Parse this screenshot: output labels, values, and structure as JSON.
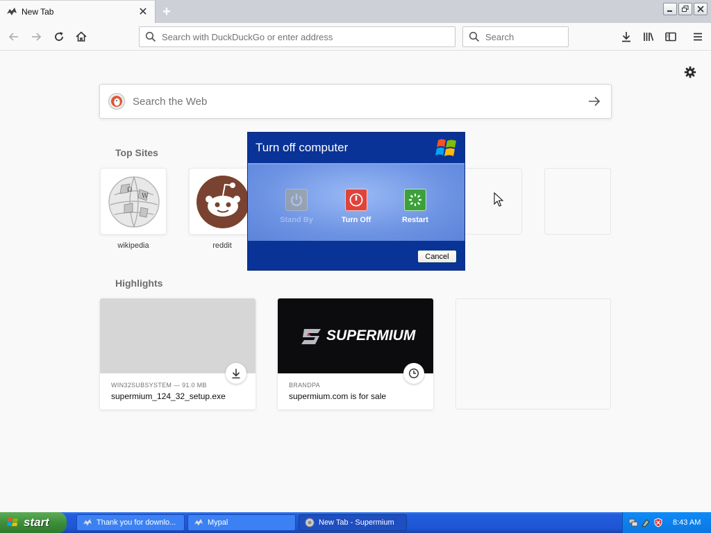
{
  "browser": {
    "tab": {
      "title": "New Tab",
      "close_glyph": "✕"
    },
    "new_tab_glyph": "+",
    "urlbar": {
      "placeholder": "Search with DuckDuckGo or enter address"
    },
    "searchbar": {
      "placeholder": "Search"
    }
  },
  "newtab": {
    "web_search_placeholder": "Search the Web",
    "top_sites_title": "Top Sites",
    "top_sites": [
      {
        "label": "wikipedia"
      },
      {
        "label": "reddit"
      }
    ],
    "highlights_title": "Highlights",
    "highlights": [
      {
        "meta": "WIN32SUBSYSTEM — 91.0 MB",
        "name": "supermium_124_32_setup.exe",
        "badge_icon": "download-icon"
      },
      {
        "meta": "BRANDPA",
        "name": "supermium.com is for sale",
        "badge_icon": "clock-icon",
        "logo_text": "SUPERMIUM"
      }
    ]
  },
  "dialog": {
    "title": "Turn off computer",
    "options": [
      {
        "label": "Stand By",
        "icon": "standby-icon",
        "enabled": false
      },
      {
        "label": "Turn Off",
        "icon": "power-icon",
        "enabled": true
      },
      {
        "label": "Restart",
        "icon": "restart-icon",
        "enabled": true
      }
    ],
    "cancel_label": "Cancel"
  },
  "taskbar": {
    "start_label": "start",
    "tasks": [
      {
        "label": "Thank you for downlo...",
        "active": false
      },
      {
        "label": "Mypal",
        "active": false
      },
      {
        "label": "New Tab - Supermium",
        "active": true
      }
    ],
    "clock": "8:43 AM"
  },
  "colors": {
    "xp_blue": "#0a3397",
    "taskbar_blue": "#245edb",
    "start_green": "#3c8f3b",
    "turn_off_red": "#e0433a",
    "restart_green": "#3ca13a"
  }
}
